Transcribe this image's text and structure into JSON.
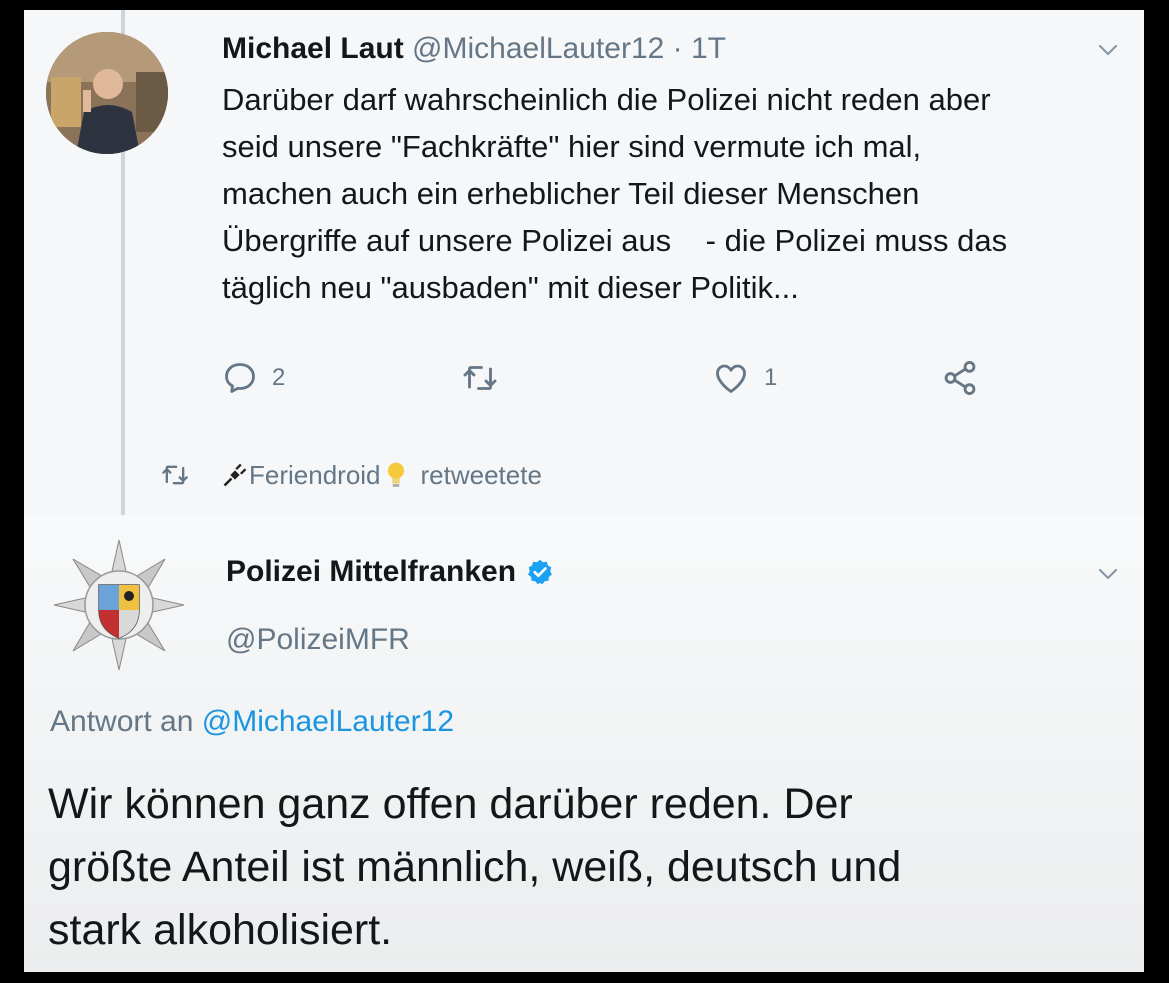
{
  "tweet1": {
    "name": "Michael Laut",
    "handle": "@MichaelLauter12",
    "separator": "·",
    "time": "1T",
    "lines": [
      "Darüber darf wahrscheinlich die Polizei nicht reden aber",
      "seid unsere \"Fachkräfte\" hier sind vermute ich mal,",
      "machen auch ein erheblicher Teil dieser Menschen",
      "Übergriffe auf unsere Polizei aus    - die Polizei muss das",
      "täglich neu \"ausbaden\" mit dieser Politik..."
    ],
    "actions": {
      "reply_count": "2",
      "retweet_count": "",
      "like_count": "1"
    }
  },
  "retweet_notice": {
    "user": "Feriendroid",
    "suffix": "retweetete"
  },
  "tweet2": {
    "name": "Polizei Mittelfranken",
    "verified": true,
    "handle": "@PolizeiMFR",
    "reply_prefix": "Antwort an",
    "reply_to": "@MichaelLauter12",
    "lines": [
      "Wir können ganz offen darüber reden. Der",
      "größte Anteil ist männlich, weiß, deutsch und",
      "stark alkoholisiert."
    ]
  },
  "colors": {
    "text": "#14171a",
    "muted": "#657786",
    "link": "#1b95e0",
    "verified": "#1da1f2",
    "background": "#f5f7f8"
  },
  "icons": [
    "reply-icon",
    "retweet-icon",
    "like-icon",
    "share-icon",
    "chevron-down-icon",
    "verified-badge-icon",
    "police-star-logo"
  ]
}
